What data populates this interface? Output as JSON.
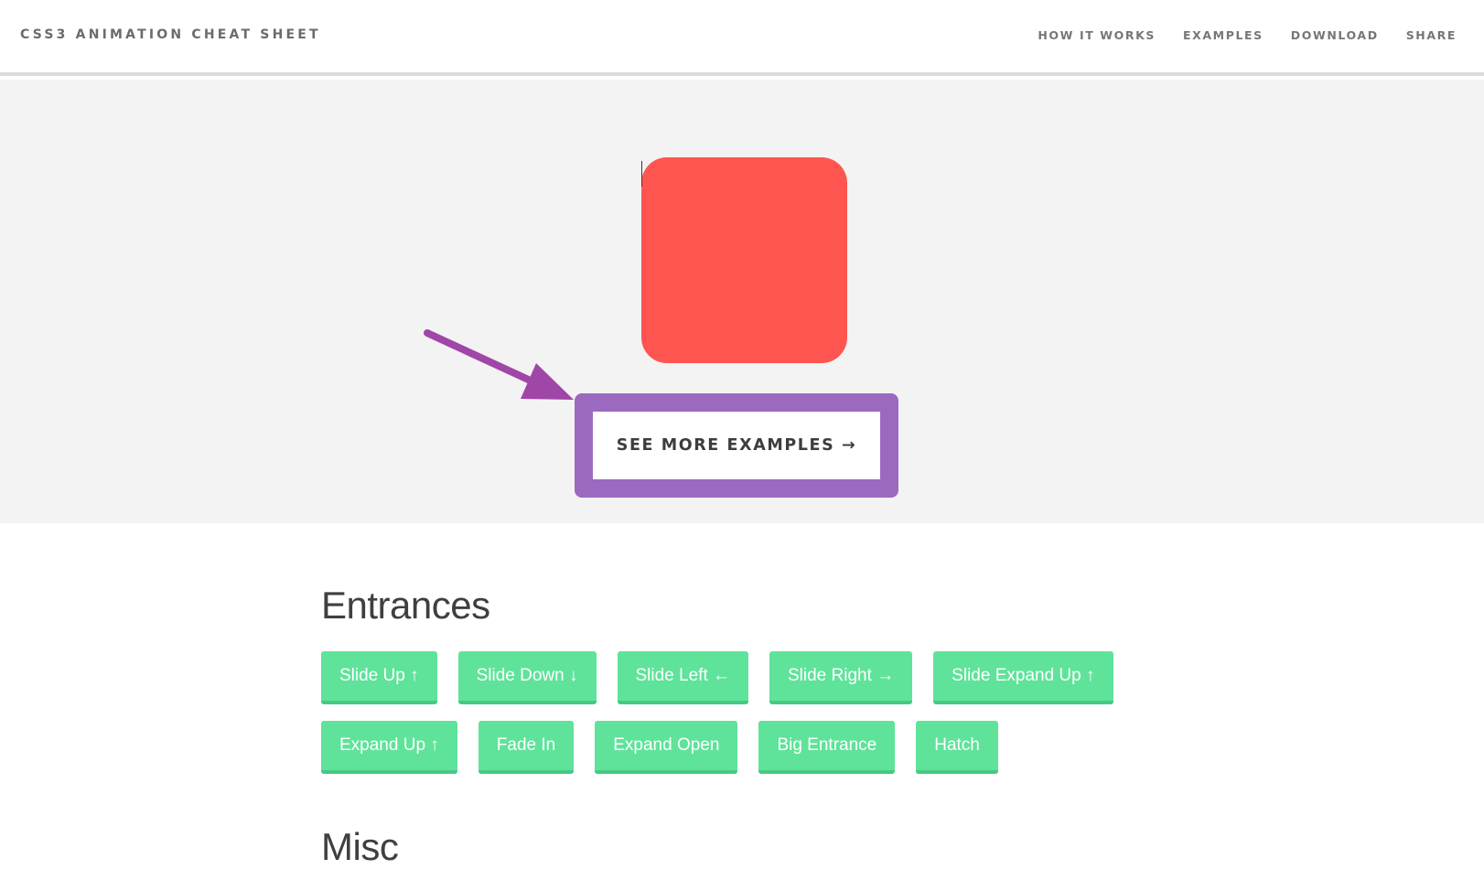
{
  "header": {
    "brand": "CSS3 ANIMATION CHEAT SHEET",
    "nav": [
      "HOW IT WORKS",
      "EXAMPLES",
      "DOWNLOAD",
      "SHARE"
    ]
  },
  "hero": {
    "demo_color": "#ff5551",
    "cta_label": "SEE MORE EXAMPLES →",
    "highlight_color": "#9b6ac0",
    "arrow_color": "#a046a8"
  },
  "sections": [
    {
      "title": "Entrances",
      "rows": [
        [
          "Slide Up ↑",
          "Slide Down ↓",
          "Slide Left ←",
          "Slide Right →",
          "Slide Expand Up ↑"
        ],
        [
          "Expand Up ↑",
          "Fade In",
          "Expand Open",
          "Big Entrance",
          "Hatch"
        ]
      ]
    },
    {
      "title": "Misc"
    }
  ],
  "colors": {
    "button_bg": "#5fe39a",
    "hero_bg": "#f3f3f3",
    "header_text": "#6b6b6b"
  }
}
